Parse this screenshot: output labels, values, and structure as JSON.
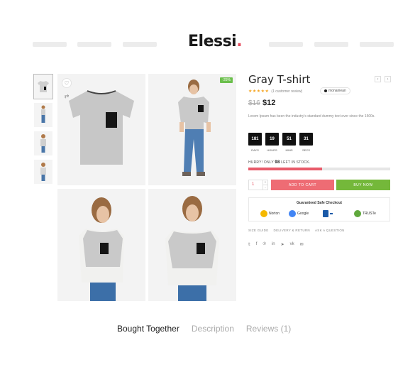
{
  "brand": {
    "name": "Elessi",
    "dot": "."
  },
  "product": {
    "title": "Gray T-shirt",
    "stars": "★★★★★",
    "reviews_text": "(1 customer review)",
    "brand_tag": "monaniean",
    "old_price": "$16",
    "new_price": "$12",
    "description": "Lorem Ipsum has been the industry's standard dummy text ever since the 1500s.",
    "sale_badge": "-25%"
  },
  "countdown": [
    {
      "value": "181",
      "label": "DAYS"
    },
    {
      "value": "19",
      "label": "HOURS"
    },
    {
      "value": "51",
      "label": "MINS"
    },
    {
      "value": "31",
      "label": "SECS"
    }
  ],
  "stock": {
    "prefix": "HURRY! ONLY",
    "count": "98",
    "suffix": "LEFT IN STOCK.",
    "fill_fraction": 0.52
  },
  "cart": {
    "quantity": "1",
    "plus": "+",
    "minus": "-",
    "add_label": "ADD TO CART",
    "buy_label": "BUY NOW"
  },
  "safe_checkout": {
    "title": "Guaranteed Safe Checkout",
    "seals": [
      {
        "label": "Norton",
        "color": "#f5b800"
      },
      {
        "label": "Google",
        "color": "#4285f4"
      },
      {
        "label": "",
        "color": "#1b5aa8"
      },
      {
        "label": "TRUSTe",
        "color": "#5fa83c"
      }
    ]
  },
  "links": [
    "SIZE GUIDE",
    "DELIVERY & RETURN",
    "ASK A QUESTION"
  ],
  "social": [
    "twitter-icon",
    "facebook-icon",
    "pinterest-icon",
    "linkedin-icon",
    "telegram-icon",
    "vk-icon",
    "email-icon"
  ],
  "social_glyphs": [
    "𝕥",
    "f",
    "℗",
    "in",
    "➤",
    "vk",
    "✉"
  ],
  "icons": {
    "wishlist": "♡",
    "compare": "⇄",
    "prev": "‹",
    "next": "›"
  },
  "tabs": [
    {
      "label": "Bought Together",
      "active": true
    },
    {
      "label": "Description",
      "active": false
    },
    {
      "label": "Reviews (1)",
      "active": false
    }
  ]
}
